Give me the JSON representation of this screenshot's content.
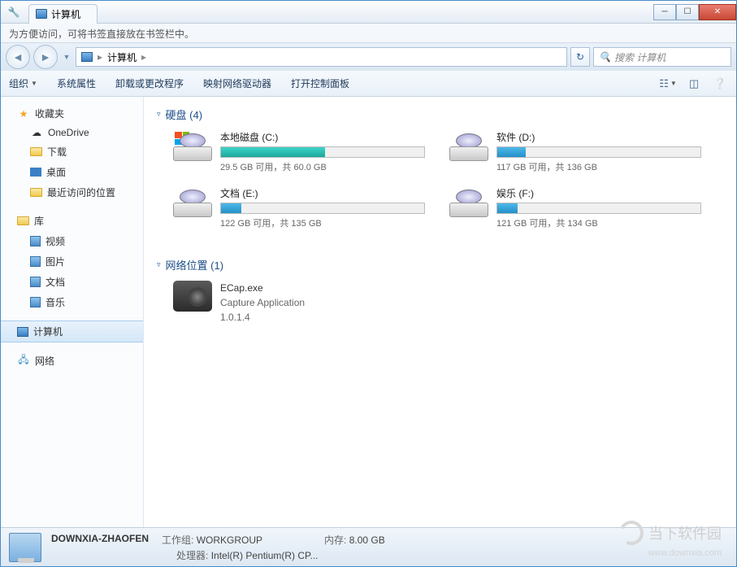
{
  "tab_title": "计算机",
  "bookmark_hint": "为方便访问，可将书签直接放在书签栏中。",
  "breadcrumb": {
    "root_icon": "pc",
    "item": "计算机",
    "sep": "▸"
  },
  "search_placeholder": "搜索 计算机",
  "toolbar": {
    "organize": "组织",
    "sys_props": "系统属性",
    "uninstall": "卸载或更改程序",
    "map_drive": "映射网络驱动器",
    "ctrl_panel": "打开控制面板"
  },
  "sidebar": {
    "favorites": {
      "label": "收藏夹",
      "items": [
        "OneDrive",
        "下载",
        "桌面",
        "最近访问的位置"
      ]
    },
    "libraries": {
      "label": "库",
      "items": [
        "视频",
        "图片",
        "文档",
        "音乐"
      ]
    },
    "computer": "计算机",
    "network": "网络"
  },
  "sections": {
    "drives": {
      "label": "硬盘 (4)"
    },
    "netloc": {
      "label": "网络位置 (1)"
    }
  },
  "drives": [
    {
      "name": "本地磁盘 (C:)",
      "free": "29.5 GB 可用，共 60.0 GB",
      "pct": 51,
      "os": true
    },
    {
      "name": "软件 (D:)",
      "free": "117 GB 可用，共 136 GB",
      "pct": 14
    },
    {
      "name": "文档 (E:)",
      "free": "122 GB 可用，共 135 GB",
      "pct": 10
    },
    {
      "name": "娱乐 (F:)",
      "free": "121 GB 可用，共 134 GB",
      "pct": 10
    }
  ],
  "netitem": {
    "name": "ECap.exe",
    "desc": "Capture Application",
    "ver": "1.0.1.4"
  },
  "status": {
    "name": "DOWNXIA-ZHAOFEN",
    "workgroup_label": "工作组:",
    "workgroup": "WORKGROUP",
    "mem_label": "内存:",
    "mem": "8.00 GB",
    "cpu_label": "处理器:",
    "cpu": "Intel(R) Pentium(R) CP..."
  },
  "watermark": {
    "text": "当下软件园",
    "url": "www.downxia.com"
  }
}
